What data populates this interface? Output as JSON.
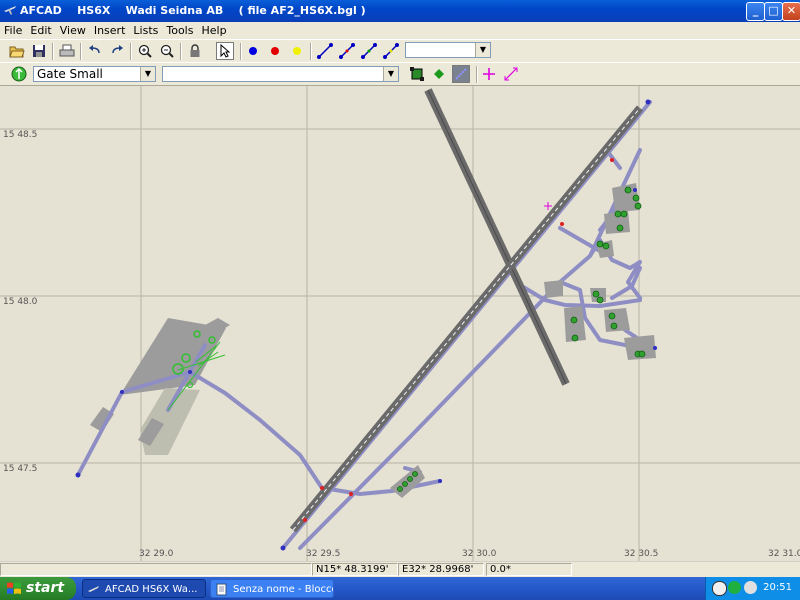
{
  "window": {
    "title": "AFCAD    HS6X    Wadi Seidna AB    ( file AF2_HS6X.bgl )",
    "minimize": "_",
    "maximize": "□",
    "close": "✕"
  },
  "menu": [
    "File",
    "Edit",
    "View",
    "Insert",
    "Lists",
    "Tools",
    "Help"
  ],
  "toolbar1": {
    "icons": [
      "open-icon",
      "save-icon",
      "print-icon",
      "undo-icon",
      "redo-icon",
      "zoom-in-icon",
      "zoom-out-icon",
      "lock-icon",
      "select-arrow-icon",
      "blue-point-icon",
      "red-point-icon",
      "yellow-point-icon",
      "taxi-path-icon",
      "runway-path-icon",
      "parking-path-icon",
      "vehicle-path-icon"
    ],
    "combo_value": ""
  },
  "toolbar2": {
    "parking_type": "Gate Small",
    "second_combo": "",
    "icons": [
      "boundary-icon",
      "green-diamond-icon",
      "apron-icon",
      "crosshair-icon",
      "measure-icon"
    ]
  },
  "map": {
    "lat_labels": [
      "15 48.5",
      "15 48.0",
      "15 47.5"
    ],
    "lon_labels": [
      "32 29.0",
      "32 29.5",
      "32 30.0",
      "32 30.5",
      "32 31.0"
    ],
    "colors": {
      "background": "#e6e2d3",
      "taxiway": "#8e8ec4",
      "runway": "#6a6a6a",
      "apron": "#9c9c9c",
      "grid": "#b8b4a4"
    }
  },
  "status": {
    "blank": "",
    "lat": "N15* 48.3199'",
    "lon": "E32* 28.9968'",
    "heading": "0.0*"
  },
  "taskbar": {
    "start": "start",
    "tasks": [
      {
        "label": "AFCAD    HS6X    Wa...",
        "active": true
      },
      {
        "label": "Senza nome - Blocco ...",
        "active": false
      }
    ],
    "clock": "20:51"
  }
}
